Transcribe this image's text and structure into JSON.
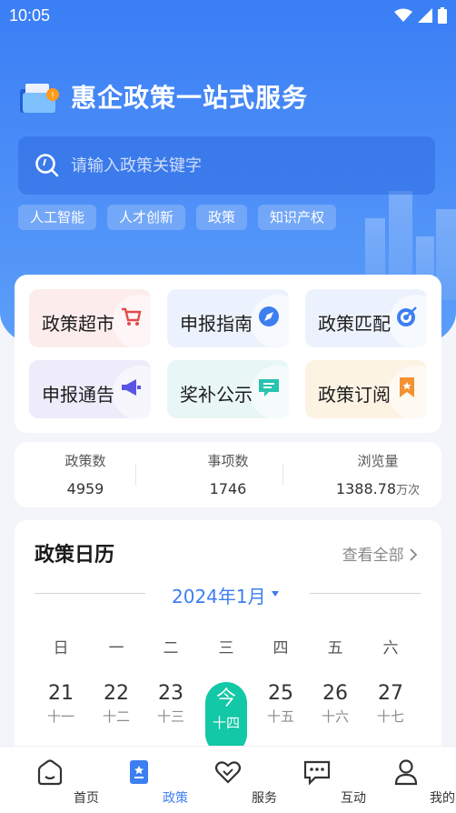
{
  "status_bar": {
    "time": "10:05"
  },
  "header": {
    "title": "惠企政策一站式服务"
  },
  "search": {
    "placeholder": "请输入政策关键字"
  },
  "tags": [
    "人工智能",
    "人才创新",
    "政策",
    "知识产权"
  ],
  "services": [
    {
      "label": "政策超市",
      "icon": "cart-icon",
      "bg": "#fdecec",
      "icon_color": "#e24a4a"
    },
    {
      "label": "申报指南",
      "icon": "compass-icon",
      "bg": "#ecf2fd",
      "icon_color": "#3d7ef0"
    },
    {
      "label": "政策匹配",
      "icon": "target-icon",
      "bg": "#ecf2fd",
      "icon_color": "#3d7ef0"
    },
    {
      "label": "申报通告",
      "icon": "megaphone-icon",
      "bg": "#eeecfb",
      "icon_color": "#5a55e6"
    },
    {
      "label": "奖补公示",
      "icon": "message-board-icon",
      "bg": "#e8f7f5",
      "icon_color": "#27c4b0"
    },
    {
      "label": "政策订阅",
      "icon": "bookmark-icon",
      "bg": "#fdf3e3",
      "icon_color": "#f39232"
    }
  ],
  "stats": [
    {
      "label": "政策数",
      "value": "4959",
      "unit": ""
    },
    {
      "label": "事项数",
      "value": "1746",
      "unit": ""
    },
    {
      "label": "浏览量",
      "value": "1388.78",
      "unit": "万次"
    }
  ],
  "calendar": {
    "title": "政策日历",
    "more_label": "查看全部",
    "month": "2024年1月",
    "weekdays": [
      "日",
      "一",
      "二",
      "三",
      "四",
      "五",
      "六"
    ],
    "days": [
      {
        "num": "21",
        "lunar": "十一"
      },
      {
        "num": "22",
        "lunar": "十二"
      },
      {
        "num": "23",
        "lunar": "十三"
      },
      {
        "num": "今",
        "lunar": "十四",
        "today": true
      },
      {
        "num": "25",
        "lunar": "十五"
      },
      {
        "num": "26",
        "lunar": "十六"
      },
      {
        "num": "27",
        "lunar": "十七"
      }
    ]
  },
  "tabbar": {
    "items": [
      {
        "label": "首页",
        "icon": "home-icon"
      },
      {
        "label": "政策",
        "icon": "policy-icon",
        "active": true
      },
      {
        "label": "服务",
        "icon": "heart-icon"
      },
      {
        "label": "互动",
        "icon": "chat-icon"
      },
      {
        "label": "我的",
        "icon": "user-icon"
      }
    ]
  },
  "colors": {
    "primary": "#3d7ef0",
    "today": "#12c8a6",
    "hero": "#4a8cf7"
  }
}
